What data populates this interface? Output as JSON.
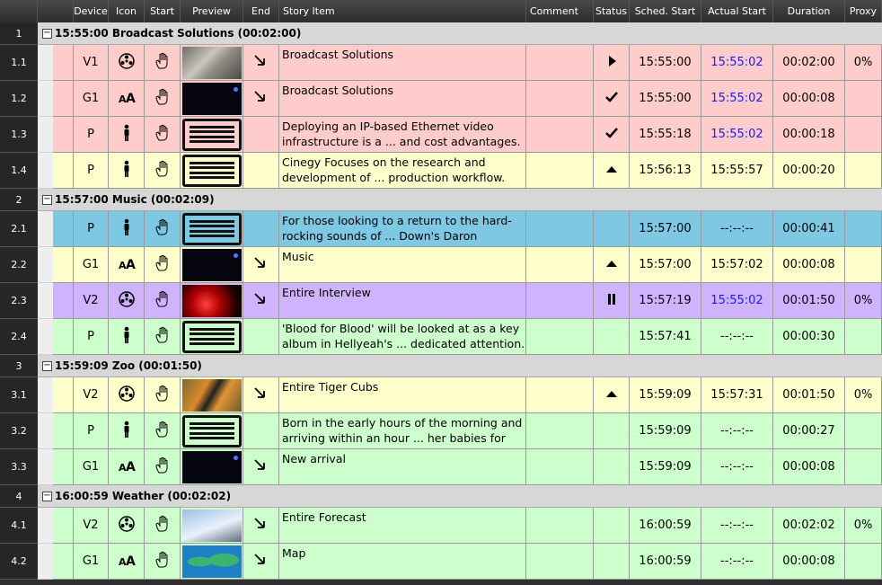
{
  "columns": {
    "device": "Device",
    "icon": "Icon",
    "start": "Start",
    "preview": "Preview",
    "end": "End",
    "story": "Story Item",
    "comment": "Comment",
    "status": "Status",
    "sched": "Sched. Start",
    "actual": "Actual Start",
    "duration": "Duration",
    "proxy": "Proxy"
  },
  "colors": {
    "pink": "#ffcccc",
    "yellow": "#ffffcc",
    "green": "#ccffcc",
    "blue": "#7ec8e3",
    "purple": "#cfb3ff",
    "group": "#d7d7d7"
  },
  "groups": [
    {
      "num": "1",
      "toggle": "−",
      "title": "15:55:00  Broadcast Solutions (00:02:00)",
      "rows": [
        {
          "num": "1.1",
          "color": "pink",
          "device": "V1",
          "icon": "reel-icon",
          "start": "hand-icon",
          "preview": "tape",
          "end": "arrow-icon",
          "story": "Broadcast Solutions",
          "comment": "",
          "status": "play-icon",
          "sched": "15:55:00",
          "actual": "15:55:02",
          "actual_blue": true,
          "duration": "00:02:00",
          "proxy": "0%"
        },
        {
          "num": "1.2",
          "color": "pink",
          "device": "G1",
          "icon": "text-aa-icon",
          "start": "hand-icon",
          "preview": "black",
          "end": "arrow-icon",
          "story": "Broadcast Solutions",
          "comment": "",
          "status": "check-icon",
          "sched": "15:55:00",
          "actual": "15:55:02",
          "actual_blue": true,
          "duration": "00:00:08",
          "proxy": ""
        },
        {
          "num": "1.3",
          "color": "pink",
          "device": "P",
          "icon": "person-icon",
          "start": "hand-icon",
          "preview": "lines",
          "end": "",
          "story": "Deploying an IP-based Ethernet video infrastructure is a ... and cost advantages.",
          "comment": "",
          "status": "check-icon",
          "sched": "15:55:18",
          "actual": "15:55:02",
          "actual_blue": true,
          "duration": "00:00:18",
          "proxy": ""
        },
        {
          "num": "1.4",
          "color": "yellow",
          "device": "P",
          "icon": "person-icon",
          "start": "hand-icon",
          "preview": "lines",
          "end": "",
          "story": "Cinegy Focuses on the research and development of ... production workflow.",
          "comment": "",
          "status": "up-icon",
          "sched": "15:56:13",
          "actual": "15:55:57",
          "actual_blue": false,
          "duration": "00:00:20",
          "proxy": ""
        }
      ]
    },
    {
      "num": "2",
      "toggle": "−",
      "title": "15:57:00  Music (00:02:09)",
      "rows": [
        {
          "num": "2.1",
          "color": "blue",
          "device": "P",
          "icon": "person-icon",
          "start": "hand-icon",
          "preview": "lines",
          "end": "",
          "story": "For those looking to a return to the hard-rocking sounds of ... Down's Daron Malakian.",
          "comment": "",
          "status": "",
          "sched": "15:57:00",
          "actual": "--:--:--",
          "actual_blue": false,
          "duration": "00:00:41",
          "proxy": ""
        },
        {
          "num": "2.2",
          "color": "yellow",
          "device": "G1",
          "icon": "text-aa-icon",
          "start": "hand-icon",
          "preview": "black",
          "end": "arrow-icon",
          "story": "Music",
          "comment": "",
          "status": "up-icon",
          "sched": "15:57:00",
          "actual": "15:57:02",
          "actual_blue": false,
          "duration": "00:00:08",
          "proxy": ""
        },
        {
          "num": "2.3",
          "color": "purple",
          "device": "V2",
          "icon": "reel-icon",
          "start": "hand-icon",
          "preview": "concert",
          "end": "arrow-icon",
          "story": "Entire Interview",
          "comment": "",
          "status": "pause-icon",
          "sched": "15:57:19",
          "actual": "15:55:02",
          "actual_blue": true,
          "duration": "00:01:50",
          "proxy": "0%"
        },
        {
          "num": "2.4",
          "color": "green",
          "device": "P",
          "icon": "person-icon",
          "start": "hand-icon",
          "preview": "lines",
          "end": "",
          "story": "'Blood for Blood' will be looked at as a key album in Hellyeah's ... dedicated attention.",
          "comment": "",
          "status": "",
          "sched": "15:57:41",
          "actual": "--:--:--",
          "actual_blue": false,
          "duration": "00:00:30",
          "proxy": ""
        }
      ]
    },
    {
      "num": "3",
      "toggle": "−",
      "title": "15:59:09  Zoo (00:01:50)",
      "rows": [
        {
          "num": "3.1",
          "color": "yellow",
          "device": "V2",
          "icon": "reel-icon",
          "start": "hand-icon",
          "preview": "tiger",
          "end": "arrow-icon",
          "story": "Entire Tiger Cubs",
          "comment": "",
          "status": "up-icon",
          "sched": "15:59:09",
          "actual": "15:57:31",
          "actual_blue": false,
          "duration": "00:01:50",
          "proxy": "0%"
        },
        {
          "num": "3.2",
          "color": "green",
          "device": "P",
          "icon": "person-icon",
          "start": "hand-icon",
          "preview": "lines",
          "end": "",
          "story": "Born in the early hours of the morning and arriving within an hour ... her babies for food.",
          "comment": "",
          "status": "",
          "sched": "15:59:09",
          "actual": "--:--:--",
          "actual_blue": false,
          "duration": "00:00:27",
          "proxy": ""
        },
        {
          "num": "3.3",
          "color": "green",
          "device": "G1",
          "icon": "text-aa-icon",
          "start": "hand-icon",
          "preview": "black",
          "end": "arrow-icon",
          "story": "New arrival",
          "comment": "",
          "status": "",
          "sched": "15:59:09",
          "actual": "--:--:--",
          "actual_blue": false,
          "duration": "00:00:08",
          "proxy": ""
        }
      ]
    },
    {
      "num": "4",
      "toggle": "−",
      "title": "16:00:59  Weather (00:02:02)",
      "rows": [
        {
          "num": "4.1",
          "color": "green",
          "device": "V2",
          "icon": "reel-icon",
          "start": "hand-icon",
          "preview": "snow",
          "end": "arrow-icon",
          "story": "Entire Forecast",
          "comment": "",
          "status": "",
          "sched": "16:00:59",
          "actual": "--:--:--",
          "actual_blue": false,
          "duration": "00:02:02",
          "proxy": "0%"
        },
        {
          "num": "4.2",
          "color": "green",
          "device": "G1",
          "icon": "text-aa-icon",
          "start": "hand-icon",
          "preview": "map",
          "end": "arrow-icon",
          "story": "Map",
          "comment": "",
          "status": "",
          "sched": "16:00:59",
          "actual": "--:--:--",
          "actual_blue": false,
          "duration": "00:00:08",
          "proxy": ""
        }
      ]
    }
  ]
}
